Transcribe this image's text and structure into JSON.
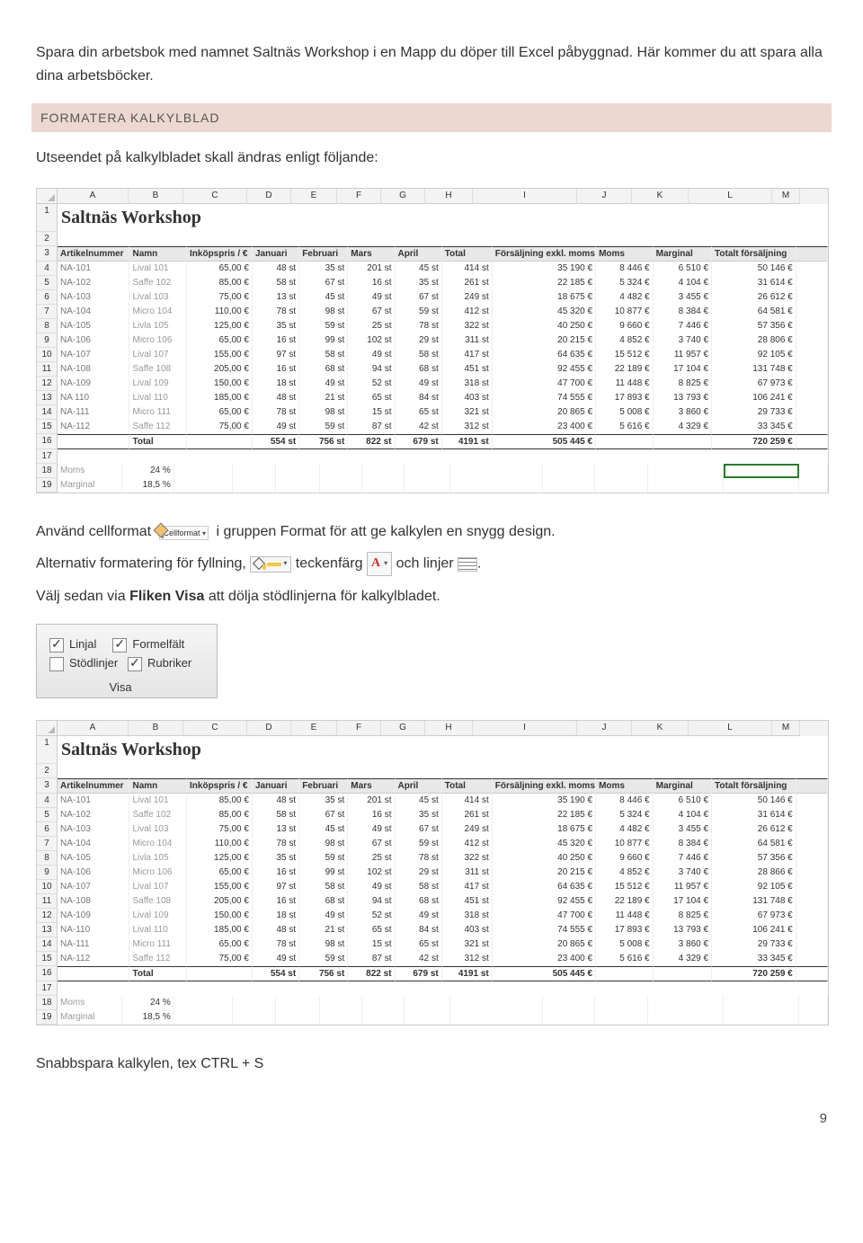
{
  "intro": "Spara din arbetsbok med namnet Saltnäs Workshop i en Mapp du döper till Excel påbyggnad. Här kommer du att spara alla dina arbetsböcker.",
  "section_header": "FORMATERA KALKYLBLAD",
  "line1": "Utseendet på kalkylbladet skall ändras enligt följande:",
  "cellformat_label": "Cellformat",
  "line2_a": "Använd cellformat",
  "line2_b": "i gruppen Format för att ge kalkylen en snygg design.",
  "line3_a": "Alternativ formatering för fyllning,",
  "line3_b": "teckenfärg",
  "line3_c": "och linjer",
  "line3_d": ".",
  "line4_a": "Välj sedan via ",
  "line4_b": "Fliken Visa",
  "line4_c": " att dölja stödlinjerna för kalkylbladet.",
  "visa": {
    "linjal": "Linjal",
    "formelfalt": "Formelfält",
    "stodlinjer": "Stödlinjer",
    "rubriker": "Rubriker",
    "title": "Visa"
  },
  "footer": "Snabbspara kalkylen, tex CTRL + S",
  "page_num": "9",
  "cols": [
    "A",
    "B",
    "C",
    "D",
    "E",
    "F",
    "G",
    "H",
    "I",
    "J",
    "K",
    "L",
    "M"
  ],
  "sheet": {
    "title": "Saltnäs Workshop",
    "headers": [
      "Artikelnummer",
      "Namn",
      "Inköpspris / €",
      "Januari",
      "Februari",
      "Mars",
      "April",
      "Total",
      "Försäljning exkl. moms",
      "Moms",
      "Marginal",
      "Totalt försäljning"
    ],
    "rows": [
      [
        "NA-101",
        "Lival 101",
        "65,00 €",
        "48 st",
        "35 st",
        "201 st",
        "45 st",
        "414 st",
        "35 190 €",
        "8 446 €",
        "6 510 €",
        "50 146 €"
      ],
      [
        "NA-102",
        "Saffe 102",
        "85,00 €",
        "58 st",
        "67 st",
        "16 st",
        "35 st",
        "261 st",
        "22 185 €",
        "5 324 €",
        "4 104 €",
        "31 614 €"
      ],
      [
        "NA-103",
        "Lival 103",
        "75,00 €",
        "13 st",
        "45 st",
        "49 st",
        "67 st",
        "249 st",
        "18 675 €",
        "4 482 €",
        "3 455 €",
        "26 612 €"
      ],
      [
        "NA-104",
        "Micro 104",
        "110,00 €",
        "78 st",
        "98 st",
        "67 st",
        "59 st",
        "412 st",
        "45 320 €",
        "10 877 €",
        "8 384 €",
        "64 581 €"
      ],
      [
        "NA-105",
        "Livla 105",
        "125,00 €",
        "35 st",
        "59 st",
        "25 st",
        "78 st",
        "322 st",
        "40 250 €",
        "9 660 €",
        "7 446 €",
        "57 356 €"
      ],
      [
        "NA-106",
        "Micro 106",
        "65,00 €",
        "16 st",
        "99 st",
        "102 st",
        "29 st",
        "311 st",
        "20 215 €",
        "4 852 €",
        "3 740 €",
        "28 806 €"
      ],
      [
        "NA-107",
        "Lival 107",
        "155,00 €",
        "97 st",
        "58 st",
        "49 st",
        "58 st",
        "417 st",
        "64 635 €",
        "15 512 €",
        "11 957 €",
        "92 105 €"
      ],
      [
        "NA-108",
        "Saffe 108",
        "205,00 €",
        "16 st",
        "68 st",
        "94 st",
        "68 st",
        "451 st",
        "92 455 €",
        "22 189 €",
        "17 104 €",
        "131 748 €"
      ],
      [
        "NA-109",
        "Lival 109",
        "150,00 €",
        "18 st",
        "49 st",
        "52 st",
        "49 st",
        "318 st",
        "47 700 €",
        "11 448 €",
        "8 825 €",
        "67 973 €"
      ],
      [
        "NA 110",
        "Lival 110",
        "185,00 €",
        "48 st",
        "21 st",
        "65 st",
        "84 st",
        "403 st",
        "74 555 €",
        "17 893 €",
        "13 793 €",
        "106 241 €"
      ],
      [
        "NA-111",
        "Micro 111",
        "65,00 €",
        "78 st",
        "98 st",
        "15 st",
        "65 st",
        "321 st",
        "20 865 €",
        "5 008 €",
        "3 860 €",
        "29 733 €"
      ],
      [
        "NA-112",
        "Saffe 112",
        "75,00 €",
        "49 st",
        "59 st",
        "87 st",
        "42 st",
        "312 st",
        "23 400 €",
        "5 616 €",
        "4 329 €",
        "33 345 €"
      ]
    ],
    "total_row": [
      "",
      "Total",
      "",
      "554 st",
      "756 st",
      "822 st",
      "679 st",
      "4191 st",
      "505 445 €",
      "",
      "",
      "720 259 €"
    ],
    "footer_rows": [
      [
        "Moms",
        "24 %"
      ],
      [
        "Marginal",
        "18,5 %"
      ]
    ]
  },
  "sheet2_rows": [
    [
      "NA-101",
      "Lival 101",
      "85,00 €",
      "48 st",
      "35 st",
      "201 st",
      "45 st",
      "414 st",
      "35 190 €",
      "8 446 €",
      "6 510 €",
      "50 146 €"
    ],
    [
      "NA-102",
      "Saffe 102",
      "85,00 €",
      "58 st",
      "67 st",
      "16 st",
      "35 st",
      "261 st",
      "22 185 €",
      "5 324 €",
      "4 104 €",
      "31 614 €"
    ],
    [
      "NA-103",
      "Lival 103",
      "75,00 €",
      "13 st",
      "45 st",
      "49 st",
      "67 st",
      "249 st",
      "18 675 €",
      "4 482 €",
      "3 455 €",
      "26 612 €"
    ],
    [
      "NA-104",
      "Micro 104",
      "110,00 €",
      "78 st",
      "98 st",
      "67 st",
      "59 st",
      "412 st",
      "45 320 €",
      "10 877 €",
      "8 384 €",
      "64 581 €"
    ],
    [
      "NA-105",
      "Livla 105",
      "125,00 €",
      "35 st",
      "59 st",
      "25 st",
      "78 st",
      "322 st",
      "40 250 €",
      "9 660 €",
      "7 446 €",
      "57 356 €"
    ],
    [
      "NA-106",
      "Micro 106",
      "65,00 €",
      "16 st",
      "99 st",
      "102 st",
      "29 st",
      "311 st",
      "20 215 €",
      "4 852 €",
      "3 740 €",
      "28 866 €"
    ],
    [
      "NA-107",
      "Lival 107",
      "155,00 €",
      "97 st",
      "58 st",
      "49 st",
      "58 st",
      "417 st",
      "64 635 €",
      "15 512 €",
      "11 957 €",
      "92 105 €"
    ],
    [
      "NA-108",
      "Saffe 108",
      "205,00 €",
      "16 st",
      "68 st",
      "94 st",
      "68 st",
      "451 st",
      "92 455 €",
      "22 189 €",
      "17 104 €",
      "131 748 €"
    ],
    [
      "NA-109",
      "Lival 109",
      "150,00 €",
      "18 st",
      "49 st",
      "52 st",
      "49 st",
      "318 st",
      "47 700 €",
      "11 448 €",
      "8 825 €",
      "67 973 €"
    ],
    [
      "NA-110",
      "Lival 110",
      "185,00 €",
      "48 st",
      "21 st",
      "65 st",
      "84 st",
      "403 st",
      "74 555 €",
      "17 893 €",
      "13 793 €",
      "106 241 €"
    ],
    [
      "NA-111",
      "Micro 111",
      "65,00 €",
      "78 st",
      "98 st",
      "15 st",
      "65 st",
      "321 st",
      "20 865 €",
      "5 008 €",
      "3 860 €",
      "29 733 €"
    ],
    [
      "NA-112",
      "Saffe 112",
      "75,00 €",
      "49 st",
      "59 st",
      "87 st",
      "42 st",
      "312 st",
      "23 400 €",
      "5 616 €",
      "4 329 €",
      "33 345 €"
    ]
  ]
}
